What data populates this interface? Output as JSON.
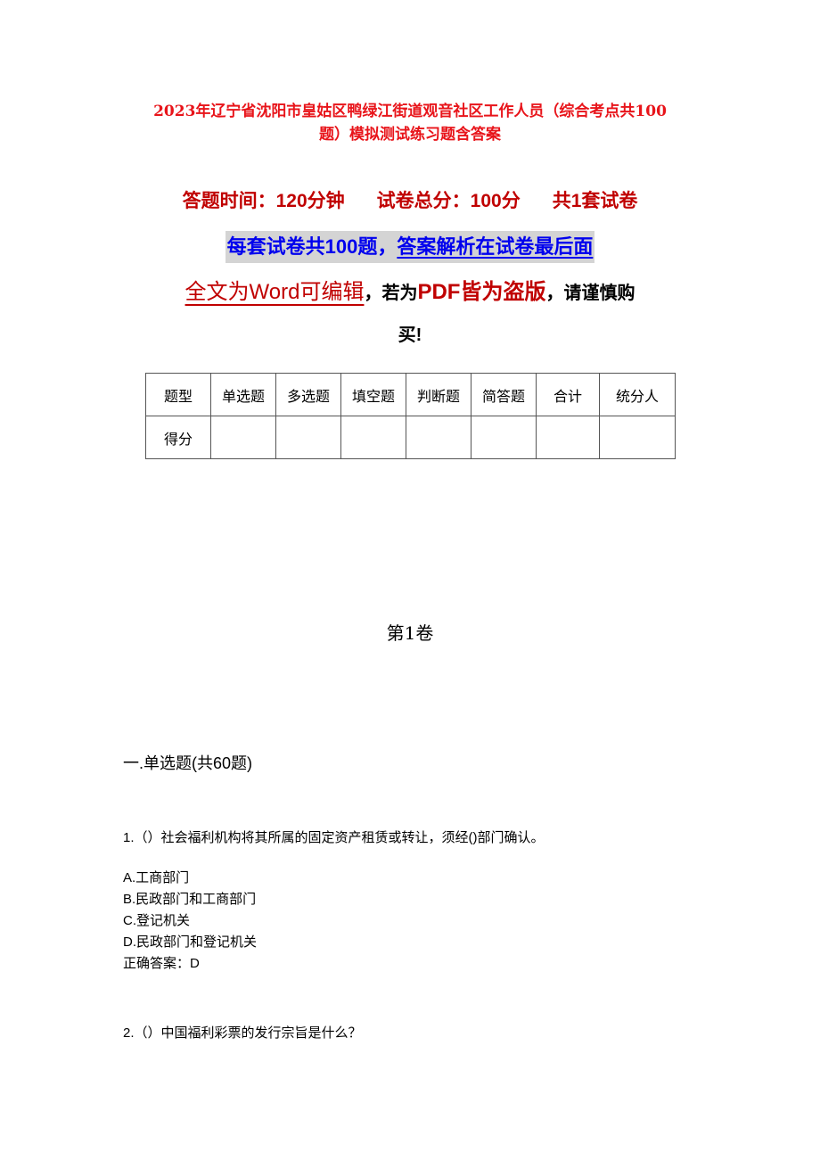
{
  "document": {
    "title_line1": "2023年辽宁省沈阳市皇姑区鸭绿江街道观音社区工作人员（综合考点共100",
    "title_line2": "题）模拟测试练习题含答案",
    "meta": {
      "time": "答题时间：120分钟",
      "total_score": "试卷总分：100分",
      "sets": "共1套试卷"
    },
    "notice": {
      "part1": "每套试卷共100题，",
      "part2": "答案解析在试卷最后面"
    },
    "warning": {
      "part1": "全文为Word可编辑",
      "part2": "，若为",
      "part3": "PDF皆为盗版",
      "part4": "，请谨慎购",
      "part5": "买!"
    },
    "colors": {
      "title_red": "#e8141a",
      "meta_red": "#c00000",
      "notice_blue": "#0000ee",
      "notice_bg": "#d4d4d4"
    }
  },
  "score_table": {
    "header": [
      "题型",
      "单选题",
      "多选题",
      "填空题",
      "判断题",
      "简答题",
      "合计",
      "统分人"
    ],
    "row": [
      "得分",
      "",
      "",
      "",
      "",
      "",
      "",
      ""
    ]
  },
  "volume_title": "第1卷",
  "section": {
    "title": "一.单选题(共60题)"
  },
  "questions": [
    {
      "text": "1.（）社会福利机构将其所属的固定资产租赁或转让，须经()部门确认。",
      "options": [
        "A.工商部门",
        "B.民政部门和工商部门",
        "C.登记机关",
        "D.民政部门和登记机关"
      ],
      "answer": "正确答案：D"
    },
    {
      "text": "2.（）中国福利彩票的发行宗旨是什么？"
    }
  ]
}
